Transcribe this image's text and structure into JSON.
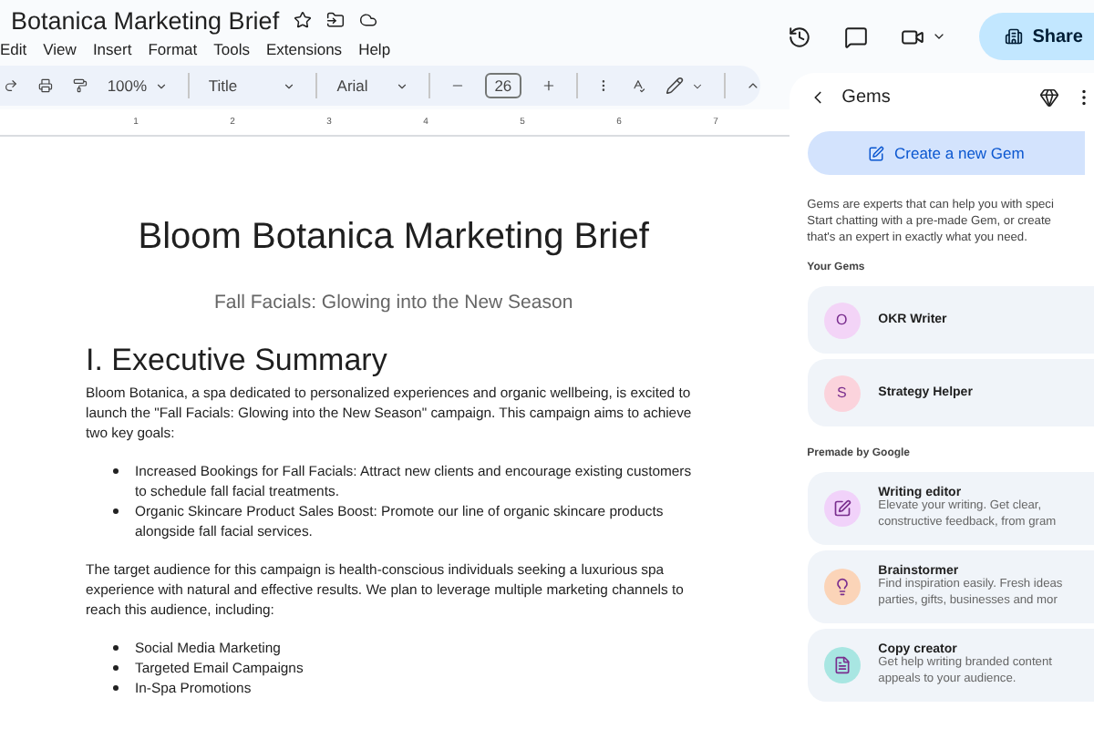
{
  "document_title": "Botanica Marketing Brief",
  "menu": [
    "Edit",
    "View",
    "Insert",
    "Format",
    "Tools",
    "Extensions",
    "Help"
  ],
  "toolbar": {
    "zoom": "100%",
    "style": "Title",
    "font": "Arial",
    "font_size": "26"
  },
  "ruler": [
    "1",
    "2",
    "3",
    "4",
    "5",
    "6",
    "7"
  ],
  "share_button": "Share",
  "document": {
    "title": "Bloom Botanica Marketing Brief",
    "subtitle": "Fall Facials: Glowing into the New Season",
    "heading": "I. Executive Summary",
    "blocks": [
      {
        "kind": "paragraph",
        "text": "Bloom Botanica, a spa dedicated to personalized experiences and organic wellbeing, is excited to launch the \"Fall Facials: Glowing into the New Season\" campaign. This campaign aims to achieve two key goals:"
      },
      {
        "kind": "list",
        "items": [
          "Increased Bookings for Fall Facials: Attract new clients and encourage existing customers to schedule fall facial treatments.",
          "Organic Skincare Product Sales Boost:  Promote our line of organic skincare products alongside fall facial services."
        ]
      },
      {
        "kind": "paragraph",
        "text": "The target audience for this campaign is health-conscious individuals seeking a luxurious spa experience with natural and effective results. We plan to leverage multiple marketing channels to reach this audience, including:"
      },
      {
        "kind": "list",
        "items": [
          "Social Media Marketing",
          "Targeted Email Campaigns",
          "In-Spa Promotions"
        ]
      }
    ]
  },
  "panel": {
    "title": "Gems",
    "create_button": "Create a new Gem",
    "intro": [
      "Gems are experts that can help you with speci",
      "Start chatting with a pre-made Gem, or create",
      "that's an expert in exactly what you need."
    ],
    "your_gems_label": "Your Gems",
    "your_gems": [
      {
        "letter": "O",
        "name": "OKR Writer",
        "color": "#f3d4f7"
      },
      {
        "letter": "S",
        "name": "Strategy Helper",
        "color": "#fbd3dc"
      }
    ],
    "premade_label": "Premade by Google",
    "premade": [
      {
        "kind": "edit",
        "name": "Writing editor",
        "description": [
          "Elevate your writing. Get clear,",
          "constructive feedback, from gram"
        ],
        "color": "#f1d2fa"
      },
      {
        "kind": "bulb",
        "name": "Brainstormer",
        "description": [
          "Find inspiration easily. Fresh ideas",
          "parties, gifts, businesses and mor"
        ],
        "color": "#fbd4b8"
      },
      {
        "kind": "doc",
        "name": "Copy creator",
        "description": [
          "Get help writing branded content",
          "appeals to your audience."
        ],
        "color": "#a8e6e2"
      }
    ]
  }
}
